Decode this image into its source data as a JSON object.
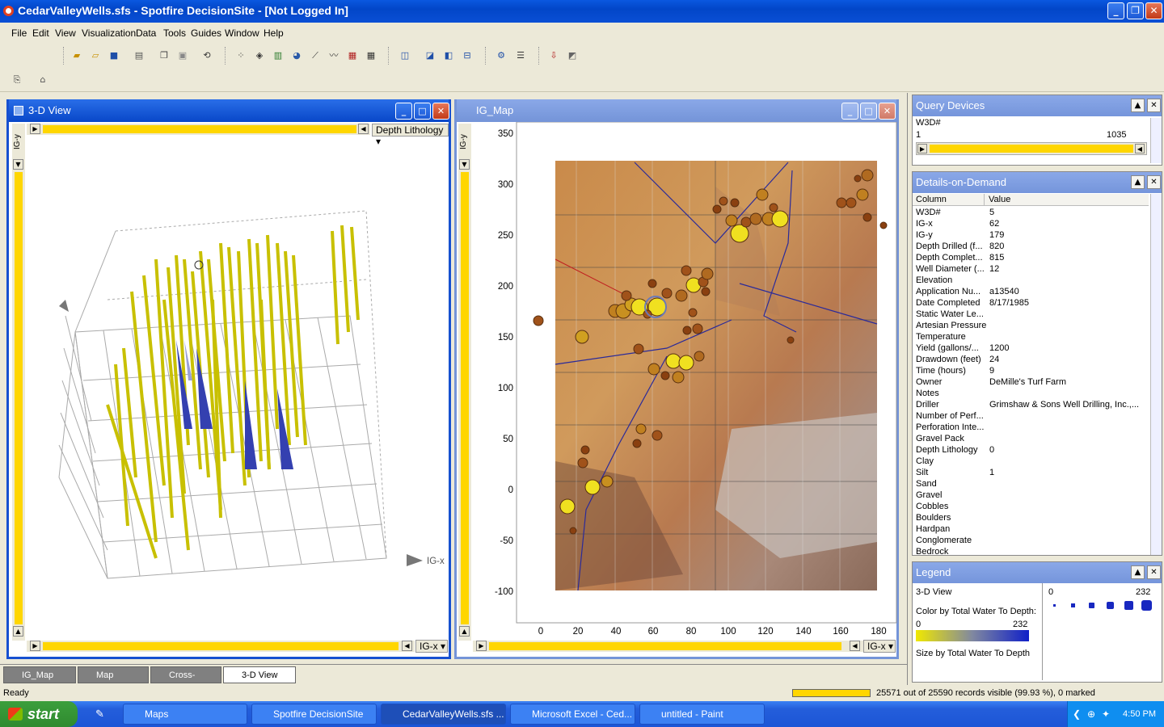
{
  "window": {
    "title": "CedarValleyWells.sfs - Spotfire DecisionSite - [Not Logged In]"
  },
  "menu": [
    "File",
    "Edit",
    "View",
    "Visualization",
    "Data",
    "Tools",
    "Guides",
    "Window",
    "Help"
  ],
  "view3d": {
    "title": "3-D View",
    "color_axis": "Depth Lithology",
    "y_axis_tab": "IG-y",
    "x_axis": "IG-x",
    "axis_labels": {
      "x": "IG-x",
      "y": "IG-y"
    }
  },
  "igmap": {
    "title": "IG_Map",
    "y_axis_tab": "IG-y",
    "x_axis": "IG-x",
    "x_ticks": [
      "0",
      "20",
      "40",
      "60",
      "80",
      "100",
      "120",
      "140",
      "160",
      "180"
    ],
    "y_ticks": [
      "350",
      "300",
      "250",
      "200",
      "150",
      "100",
      "50",
      "0",
      "-50",
      "-100"
    ],
    "accent_color": "#ffd600"
  },
  "query_devices": {
    "title": "Query Devices",
    "field": "W3D#",
    "min": "1",
    "max": "1035"
  },
  "details": {
    "title": "Details-on-Demand",
    "col_header": "Column",
    "val_header": "Value",
    "rows": [
      [
        "W3D#",
        "5"
      ],
      [
        "IG-x",
        "62"
      ],
      [
        "IG-y",
        "179"
      ],
      [
        "Depth Drilled (f...",
        "820"
      ],
      [
        "Depth Complet...",
        "815"
      ],
      [
        "Well Diameter (...",
        "12"
      ],
      [
        "Elevation",
        ""
      ],
      [
        "Application Nu...",
        "a13540"
      ],
      [
        "Date Completed",
        "8/17/1985"
      ],
      [
        "Static Water Le...",
        ""
      ],
      [
        "Artesian Pressure",
        ""
      ],
      [
        "Temperature",
        ""
      ],
      [
        "Yield (gallons/...",
        "1200"
      ],
      [
        "Drawdown (feet)",
        "24"
      ],
      [
        "Time (hours)",
        "9"
      ],
      [
        "Owner",
        "DeMille's Turf Farm"
      ],
      [
        "Notes",
        ""
      ],
      [
        "Driller",
        "Grimshaw & Sons Well Drilling, Inc.,..."
      ],
      [
        "Number of Perf...",
        ""
      ],
      [
        "Perforation Inte...",
        ""
      ],
      [
        "Gravel Pack",
        ""
      ],
      [
        "Depth Lithology",
        "0"
      ],
      [
        "Clay",
        ""
      ],
      [
        "Silt",
        "1"
      ],
      [
        "Sand",
        ""
      ],
      [
        "Gravel",
        ""
      ],
      [
        "Cobbles",
        ""
      ],
      [
        "Boulders",
        ""
      ],
      [
        "Hardpan",
        ""
      ],
      [
        "Conglomerate",
        ""
      ],
      [
        "Bedrock",
        ""
      ]
    ]
  },
  "legend": {
    "title": "Legend",
    "view": "3-D View",
    "color_by": "Color by Total Water To Depth:",
    "color_min": "0",
    "color_max": "232",
    "size_by": "Size by Total Water To Depth",
    "size_min": "0",
    "size_max": "232"
  },
  "tabs": [
    "IG_Map",
    "Map",
    "Cross-Section",
    "3-D View"
  ],
  "status": {
    "left": "Ready",
    "records": "25571 out of 25590 records visible (99.93 %), 0 marked"
  },
  "taskbar": {
    "start": "start",
    "items": [
      "Maps",
      "Spotfire DecisionSite",
      "CedarValleyWells.sfs ...",
      "Microsoft Excel - Ced...",
      "untitled - Paint"
    ],
    "clock": "4:50 PM"
  }
}
